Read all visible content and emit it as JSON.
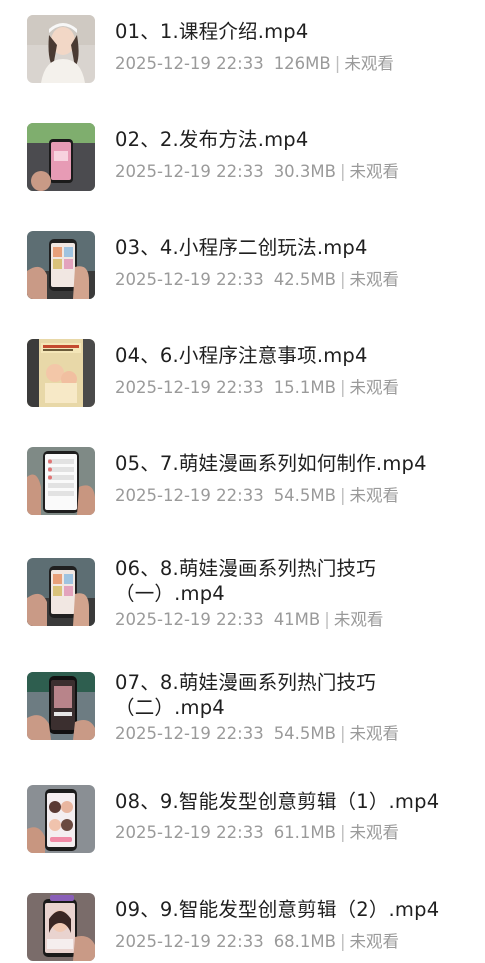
{
  "files": [
    {
      "title": "01、1.课程介绍.mp4",
      "date": "2025-12-19 22:33",
      "size": "126MB",
      "status": "未观看",
      "thumb": "person-photo"
    },
    {
      "title": "02、2.发布方法.mp4",
      "date": "2025-12-19 22:33",
      "size": "30.3MB",
      "status": "未观看",
      "thumb": "phone-on-desk"
    },
    {
      "title": "03、4.小程序二创玩法.mp4",
      "date": "2025-12-19 22:33",
      "size": "42.5MB",
      "status": "未观看",
      "thumb": "phone-in-hand"
    },
    {
      "title": "04、6.小程序注意事项.mp4",
      "date": "2025-12-19 22:33",
      "size": "15.1MB",
      "status": "未观看",
      "thumb": "poster"
    },
    {
      "title": "05、7.萌娃漫画系列如何制作.mp4",
      "date": "2025-12-19 22:33",
      "size": "54.5MB",
      "status": "未观看",
      "thumb": "phone-list"
    },
    {
      "title": "06、8.萌娃漫画系列热门技巧（一）.mp4",
      "date": "2025-12-19 22:33",
      "size": "41MB",
      "status": "未观看",
      "thumb": "phone-in-hand"
    },
    {
      "title": "07、8.萌娃漫画系列热门技巧（二）.mp4",
      "date": "2025-12-19 22:33",
      "size": "54.5MB",
      "status": "未观看",
      "thumb": "phone-dark"
    },
    {
      "title": "08、9.智能发型创意剪辑（1）.mp4",
      "date": "2025-12-19 22:33",
      "size": "61.1MB",
      "status": "未观看",
      "thumb": "phone-grid"
    },
    {
      "title": "09、9.智能发型创意剪辑（2）.mp4",
      "date": "2025-12-19 22:33",
      "size": "68.1MB",
      "status": "未观看",
      "thumb": "phone-face"
    }
  ]
}
